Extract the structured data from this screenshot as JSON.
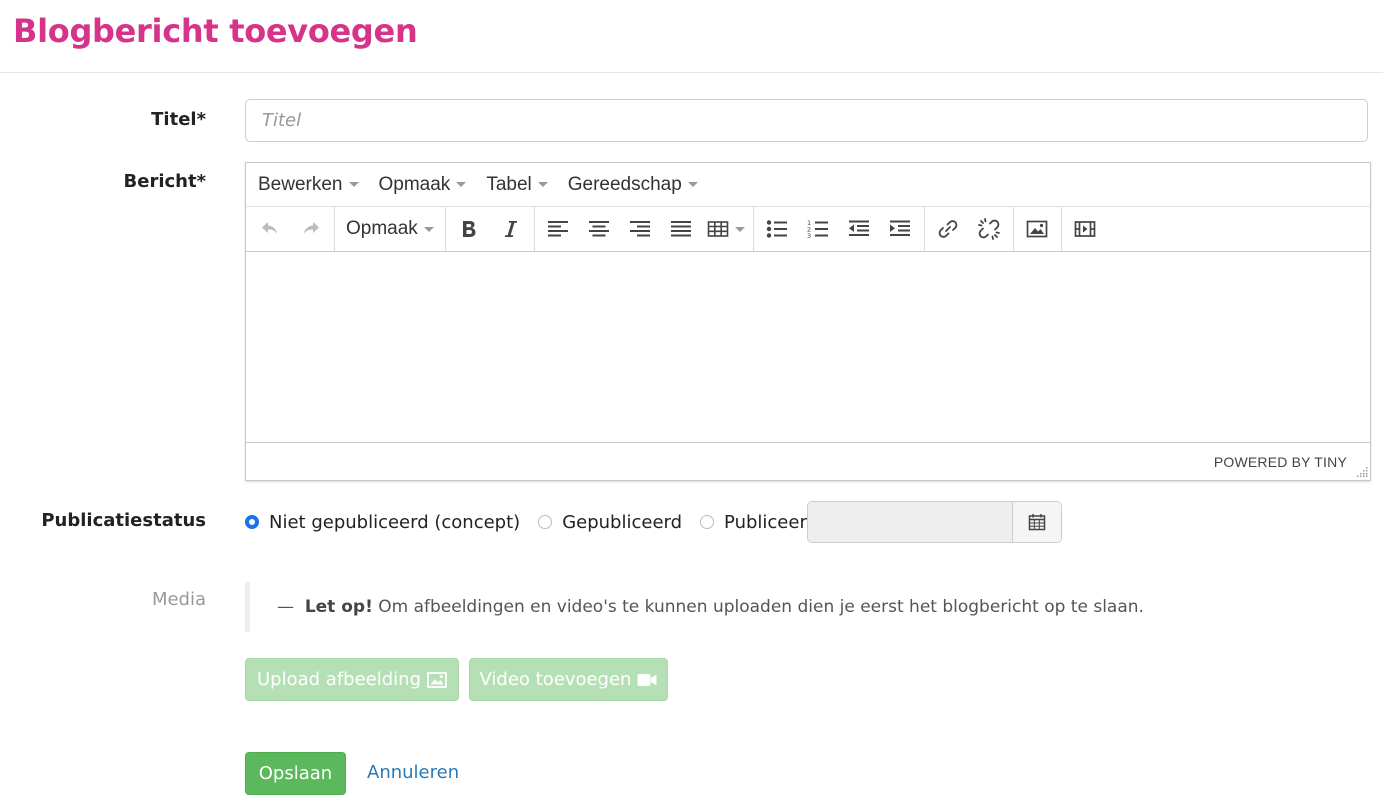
{
  "page": {
    "title": "Blogbericht toevoegen"
  },
  "form": {
    "title_label": "Titel*",
    "title_placeholder": "Titel",
    "title_value": "",
    "message_label": "Bericht*",
    "status_label": "Publicatiestatus",
    "media_label": "Media"
  },
  "editor": {
    "menu": [
      {
        "label": "Bewerken"
      },
      {
        "label": "Opmaak"
      },
      {
        "label": "Tabel"
      },
      {
        "label": "Gereedschap"
      }
    ],
    "format_dropdown": "Opmaak",
    "branding": "POWERED BY TINY",
    "icons": [
      "undo-icon",
      "redo-icon",
      "bold-icon",
      "italic-icon",
      "align-left-icon",
      "align-center-icon",
      "align-right-icon",
      "align-justify-icon",
      "table-icon",
      "bullet-list-icon",
      "numbered-list-icon",
      "outdent-icon",
      "indent-icon",
      "link-icon",
      "unlink-icon",
      "image-icon",
      "media-icon"
    ]
  },
  "status": {
    "options": [
      {
        "label": "Niet gepubliceerd (concept)",
        "checked": true
      },
      {
        "label": "Gepubliceerd",
        "checked": false
      },
      {
        "label": "Publiceer op:",
        "checked": false
      }
    ],
    "date_value": ""
  },
  "media": {
    "notice_dash": "—",
    "notice_bold": "Let op!",
    "notice_text": "Om afbeeldingen en video's te kunnen uploaden dien je eerst het blogbericht op te slaan.",
    "upload_image_label": "Upload afbeelding",
    "add_video_label": "Video toevoegen"
  },
  "actions": {
    "save_label": "Opslaan",
    "cancel_label": "Annuleren"
  },
  "colors": {
    "title": "#d6338a",
    "save": "#5cb85c",
    "disabled_button": "#b5e0b5",
    "link": "#2a7ab8",
    "radio_checked": "#1a73e8"
  }
}
